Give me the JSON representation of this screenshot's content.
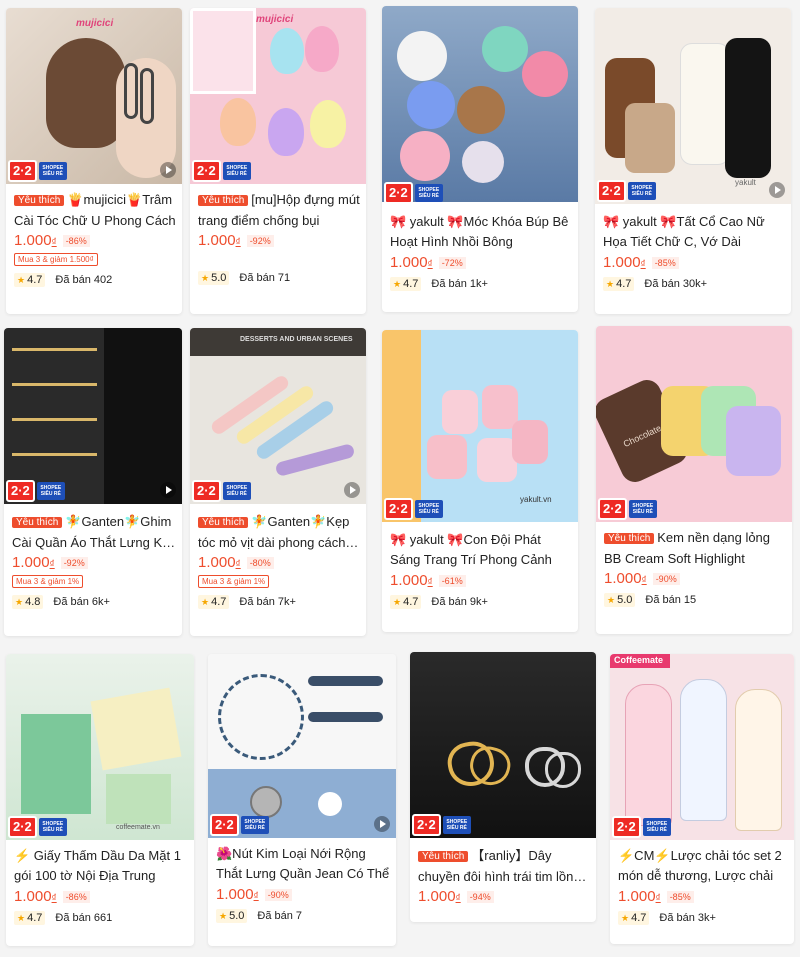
{
  "promo_badge": {
    "label": "2·2",
    "sub": "SHOPEE SIÊU RẺ"
  },
  "products": [
    {
      "tag": "Yêu thích",
      "title": "🍟mujicici🍟Trâm Cài Tóc Chữ U Phong Cách",
      "price": "1.000",
      "currency": "₫",
      "discount": "-86%",
      "promo": "Mua 3 & giảm 1.500₫",
      "rating": "4.7",
      "sold": "Đã bán 402",
      "watermark": "mujicici"
    },
    {
      "tag": "Yêu thích",
      "title": "[mu]Hộp đựng mút trang điểm chống bụi",
      "price": "1.000",
      "currency": "₫",
      "discount": "-92%",
      "promo": "",
      "rating": "5.0",
      "sold": "Đã bán 71",
      "watermark": "mujicici"
    },
    {
      "tag": "",
      "title": "🎀 yakult 🎀Móc Khóa Búp Bê Hoạt Hình Nhồi Bông",
      "price": "1.000",
      "currency": "₫",
      "discount": "-72%",
      "promo": "",
      "rating": "4.7",
      "sold": "Đã bán 1k+",
      "watermark": ""
    },
    {
      "tag": "",
      "title": "🎀 yakult 🎀Tất Cổ Cao Nữ Họa Tiết Chữ C, Vớ Dài",
      "price": "1.000",
      "currency": "₫",
      "discount": "-85%",
      "promo": "",
      "rating": "4.7",
      "sold": "Đã bán 30k+",
      "watermark": "yakult"
    },
    {
      "tag": "Yêu thích",
      "title": "🧚Ganten🧚Ghim Cài Quần Áo Thắt Lưng Kim Loại",
      "price": "1.000",
      "currency": "₫",
      "discount": "-92%",
      "promo": "Mua 3 & giảm 1%",
      "rating": "4.8",
      "sold": "Đã bán 6k+",
      "watermark": ""
    },
    {
      "tag": "Yêu thích",
      "title": "🧚Ganten🧚Kẹp tóc mỏ vịt dài phong cách Hàn",
      "price": "1.000",
      "currency": "₫",
      "discount": "-80%",
      "promo": "Mua 3 & giảm 1%",
      "rating": "4.7",
      "sold": "Đã bán 7k+",
      "watermark": "DESSERTS AND URBAN SCENES"
    },
    {
      "tag": "",
      "title": "🎀 yakult 🎀Con Đội Phát Sáng Trang Trí Phong Cảnh",
      "price": "1.000",
      "currency": "₫",
      "discount": "-61%",
      "promo": "",
      "rating": "4.7",
      "sold": "Đã bán 9k+",
      "watermark": "yakult.vn"
    },
    {
      "tag": "Yêu thích",
      "title": "Kem nền dạng lỏng BB Cream Soft Highlight",
      "price": "1.000",
      "currency": "₫",
      "discount": "-90%",
      "promo": "",
      "rating": "5.0",
      "sold": "Đã bán 15",
      "watermark": "Chocolate"
    },
    {
      "tag": "",
      "title": "⚡ Giấy Thấm Dầu Da Mặt 1 gói 100 tờ Nội Địa Trung",
      "price": "1.000",
      "currency": "₫",
      "discount": "-86%",
      "promo": "",
      "rating": "4.7",
      "sold": "Đã bán 661",
      "watermark": "coffeemate.vn"
    },
    {
      "tag": "",
      "title": "🌺Nút Kim Loại Nới Rộng Thắt Lưng Quần Jean Có Thể",
      "price": "1.000",
      "currency": "₫",
      "discount": "-90%",
      "promo": "",
      "rating": "5.0",
      "sold": "Đã bán 7",
      "watermark": ""
    },
    {
      "tag": "Yêu thích",
      "title": "【ranliy】Dây chuyền đôi hình trái tim lồng vào nhau",
      "price": "1.000",
      "currency": "₫",
      "discount": "-94%",
      "promo": "",
      "rating": "",
      "sold": "",
      "watermark": ""
    },
    {
      "tag": "",
      "title": "⚡CM⚡Lược chải tóc set 2 món dễ thương, Lược chải",
      "price": "1.000",
      "currency": "₫",
      "discount": "-85%",
      "promo": "",
      "rating": "4.7",
      "sold": "Đã bán 3k+",
      "watermark": "Coffeemate"
    }
  ],
  "colors": {
    "accent": "#ee4d2d",
    "badge_red": "#ee2a24",
    "badge_blue": "#1e4fb8",
    "star": "#f6a700"
  },
  "icons": [
    "star-icon",
    "play-icon"
  ]
}
